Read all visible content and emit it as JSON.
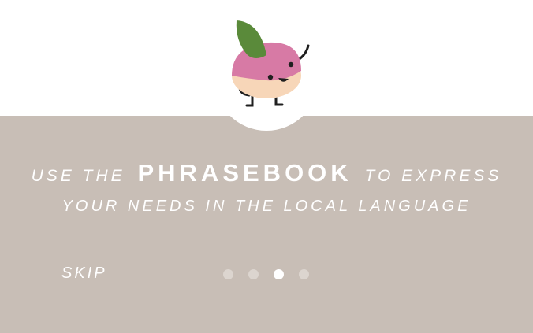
{
  "onboarding": {
    "mascot_icon": "radish-mascot-icon",
    "headline_prefix": "USE THE",
    "headline_emphasis": "PHRASEBOOK",
    "headline_suffix": "TO EXPRESS",
    "headline_line2": "YOUR NEEDS IN THE LOCAL LANGUAGE",
    "skip_label": "SKIP",
    "page_indicator": {
      "total": 4,
      "active_index": 2
    }
  },
  "colors": {
    "panel": "#c8beb6",
    "leaf": "#5a8a3a",
    "body_pink": "#d77aa5",
    "body_peach": "#f7d6b8",
    "dot_inactive": "#dcd5cf",
    "dot_active": "#ffffff"
  }
}
